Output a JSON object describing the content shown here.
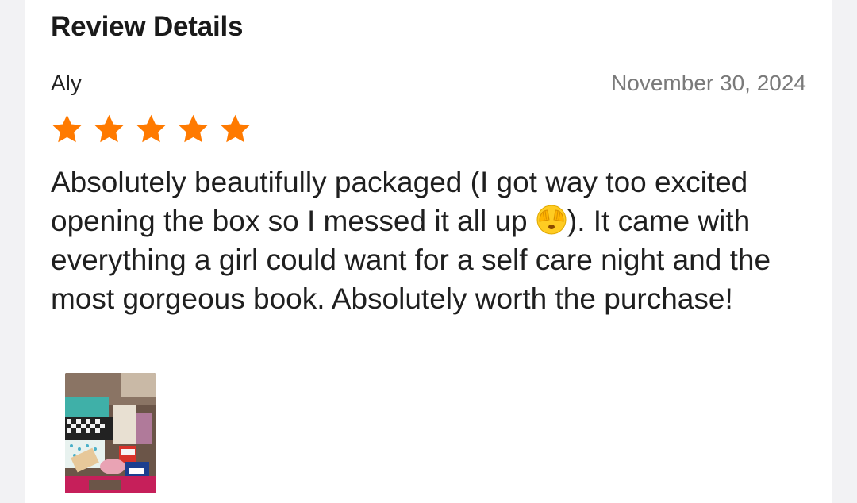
{
  "header": {
    "title": "Review Details"
  },
  "review": {
    "reviewer": "Aly",
    "date": "November 30, 2024",
    "rating": 5,
    "max_rating": 5,
    "star_color": "#ff7a00",
    "text_before_emoji": "Absolutely beautifully packaged (I got way too excited opening the box so I messed it all up ",
    "emoji": "face-with-hands-over-eyes-emoji",
    "text_after_emoji": "). It came with everything a girl could want for a self care night and the most gorgeous book. Absolutely worth the purchase!"
  },
  "photos": [
    {
      "icon": "review-photo-thumbnail"
    }
  ]
}
